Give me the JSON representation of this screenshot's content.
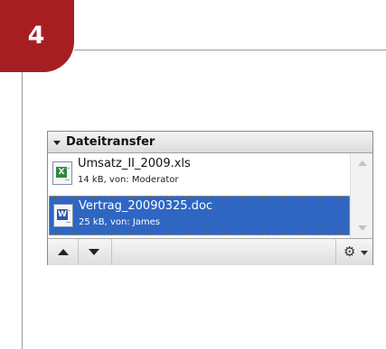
{
  "step": {
    "number": "4",
    "color": "#a71e22"
  },
  "panel": {
    "title": "Dateitransfer",
    "files": [
      {
        "name": "Umsatz_II_2009.xls",
        "meta": "14 kB, von: Moderator",
        "icon": "excel-file-icon",
        "selected": false
      },
      {
        "name": "Vertrag_20090325.doc",
        "meta": "25 kB, von: James",
        "icon": "word-file-icon",
        "selected": true
      }
    ],
    "selection_color": "#2f66c2",
    "toolbar": {
      "icons": [
        "move-up-icon",
        "move-down-icon",
        "gear-icon"
      ]
    }
  }
}
